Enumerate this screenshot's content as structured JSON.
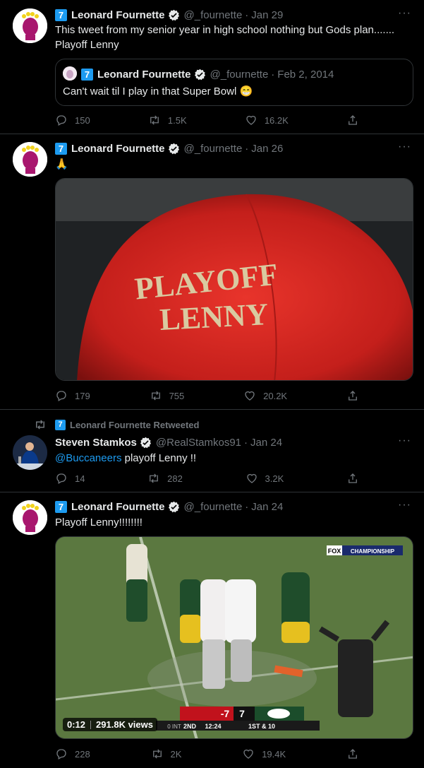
{
  "tweets": [
    {
      "badge": "7",
      "name": "Leonard Fournette",
      "handle": "@_fournette",
      "date": "Jan 29",
      "text": "This tweet from my senior year in high school nothing but Gods plan.......\nPlayoff Lenny",
      "quote": {
        "badge": "7",
        "name": "Leonard Fournette",
        "handle": "@_fournette",
        "date": "Feb 2, 2014",
        "text": "Can't wait til I play in that Super Bowl 😁"
      },
      "replies": "150",
      "retweets": "1.5K",
      "likes": "16.2K"
    },
    {
      "badge": "7",
      "name": "Leonard Fournette",
      "handle": "@_fournette",
      "date": "Jan 26",
      "text": "🙏",
      "image_text_line1": "PLAYOFF",
      "image_text_line2": "LENNY",
      "replies": "179",
      "retweets": "755",
      "likes": "20.2K"
    },
    {
      "retweet_badge": "7",
      "retweet_label": "Leonard Fournette Retweeted",
      "name": "Steven Stamkos",
      "handle": "@RealStamkos91",
      "date": "Jan 24",
      "mention": "@Buccaneers",
      "text": " playoff Lenny !!",
      "replies": "14",
      "retweets": "282",
      "likes": "3.2K"
    },
    {
      "badge": "7",
      "name": "Leonard Fournette",
      "handle": "@_fournette",
      "date": "Jan 24",
      "text": "Playoff Lenny!!!!!!!!",
      "video": {
        "duration": "0:12",
        "views": "291.8K views",
        "network": "FOX",
        "network_tag": "CHAMPIONSHIP",
        "score_left": "-7",
        "score_right": "7",
        "quarter": "2ND",
        "clock": "12:24",
        "down": "1ST & 10",
        "timeouts": "0 INT"
      },
      "replies": "228",
      "retweets": "2K",
      "likes": "19.4K"
    }
  ],
  "more_label": "···"
}
